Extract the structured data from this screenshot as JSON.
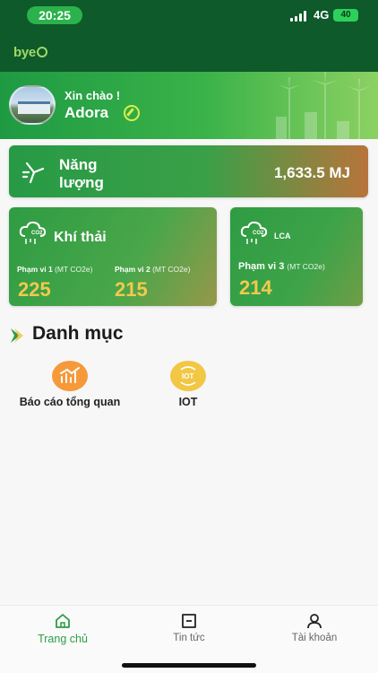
{
  "status_bar": {
    "time": "20:25",
    "network": "4G",
    "battery": "40"
  },
  "app_bar": {
    "logo": "bye"
  },
  "hero": {
    "greeting": "Xin chào !",
    "user_name": "Adora"
  },
  "energy": {
    "label": "Năng lượng",
    "value": "1,633.5 MJ"
  },
  "emission": {
    "title": "Khí thải",
    "co2_tag": "CO2",
    "scope1": {
      "label": "Phạm vi 1",
      "unit": "(MT CO2e)",
      "value": "225"
    },
    "scope2": {
      "label": "Phạm vi 2",
      "unit": "(MT CO2e)",
      "value": "215"
    }
  },
  "lca": {
    "tag": "LCA",
    "co2_tag": "CO2",
    "scope3": {
      "label": "Phạm vi 3",
      "unit": "(MT CO2e)",
      "value": "214"
    }
  },
  "catalog": {
    "title": "Danh mục",
    "items": [
      {
        "label": "Báo cáo tổng quan",
        "icon": "chart-icon",
        "color": "#f59a3b"
      },
      {
        "label": "IOT",
        "icon": "iot-icon",
        "icon_text": "IOT",
        "color": "#f2c744"
      }
    ]
  },
  "bottom_nav": {
    "items": [
      {
        "label": "Trang chủ",
        "icon": "home-icon",
        "active": true
      },
      {
        "label": "Tin tức",
        "icon": "news-icon",
        "active": false
      },
      {
        "label": "Tài khoản",
        "icon": "account-icon",
        "active": false
      }
    ]
  },
  "colors": {
    "primary_dark": "#0e5a2a",
    "primary": "#2e9c43",
    "accent": "#f2c94c"
  }
}
